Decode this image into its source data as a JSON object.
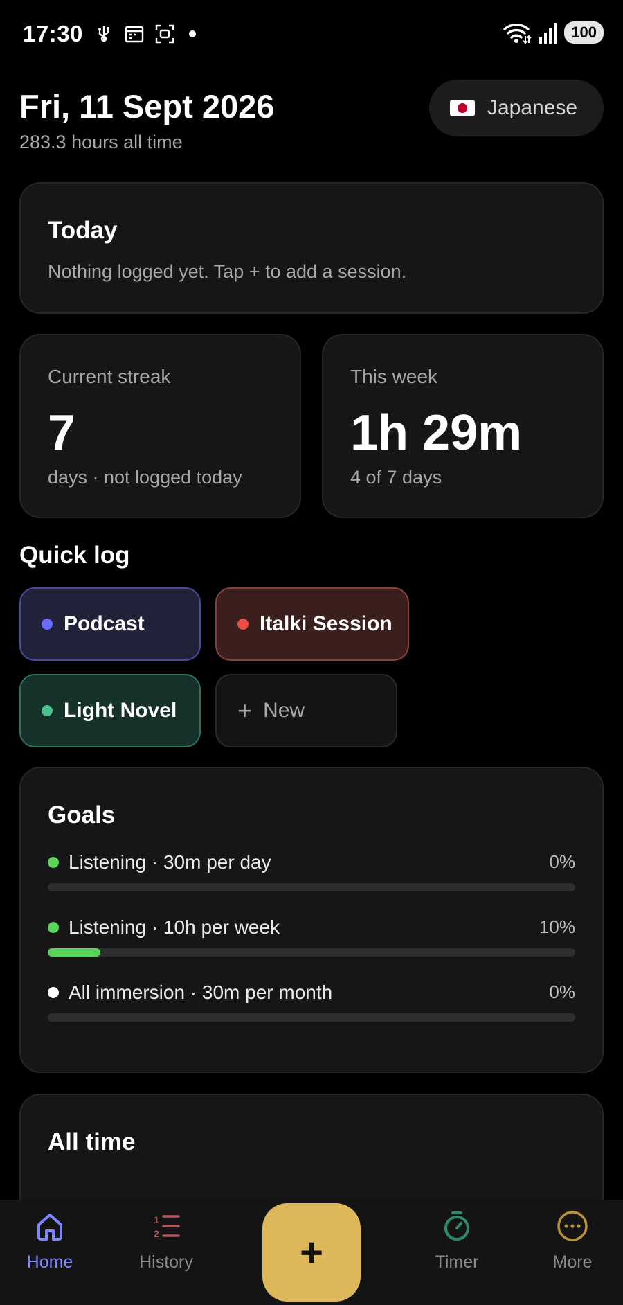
{
  "status_bar": {
    "time": "17:30",
    "battery": "100",
    "icons": [
      "usb-icon",
      "calendar-icon",
      "screenshot-icon",
      "notification-dot",
      "wifi-icon",
      "signal-icon",
      "battery-icon"
    ]
  },
  "header": {
    "date": "Fri, 11 Sept 2026",
    "total_hours": "283.3 hours all time",
    "language": "Japanese",
    "language_flag": "japan-flag-icon"
  },
  "today": {
    "title": "Today",
    "message": "Nothing logged yet. Tap + to add a session."
  },
  "stats": {
    "streak": {
      "label": "Current streak",
      "value": "7",
      "sub": "days · not logged today"
    },
    "week": {
      "label": "This week",
      "value": "1h 29m",
      "sub": "4 of 7 days"
    }
  },
  "quick_log": {
    "title": "Quick log",
    "chips": [
      {
        "label": "Podcast",
        "color": "#6b6bff"
      },
      {
        "label": "Italki Session",
        "color": "#ee4d45"
      },
      {
        "label": "Light Novel",
        "color": "#4cc18f"
      }
    ],
    "new_label": "New"
  },
  "goals": {
    "title": "Goals",
    "items": [
      {
        "label": "Listening · 30m per day",
        "pct": "0%",
        "progress": 0,
        "color": "#5ad35a"
      },
      {
        "label": "Listening · 10h per week",
        "pct": "10%",
        "progress": 0.1,
        "color": "#5ad35a"
      },
      {
        "label": "All immersion · 30m per month",
        "pct": "0%",
        "progress": 0,
        "color": "#ffffff"
      }
    ]
  },
  "all_time": {
    "title": "All time"
  },
  "nav": {
    "home": "Home",
    "history": "History",
    "timer": "Timer",
    "more": "More",
    "fab_label": "+",
    "accent_home": "#7f86ff",
    "fab_color": "#dcb85a"
  }
}
